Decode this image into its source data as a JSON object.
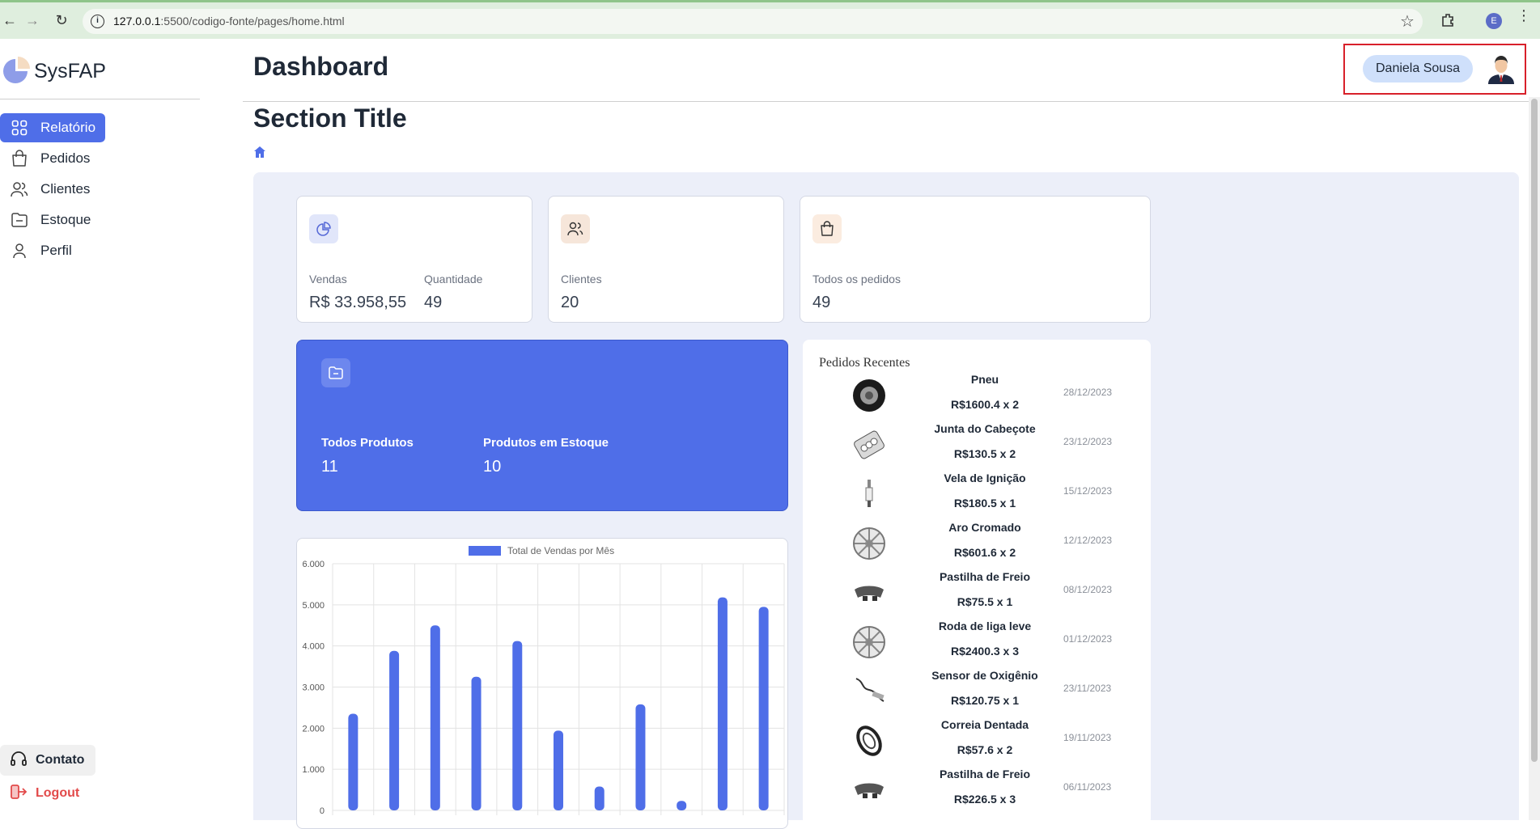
{
  "browser": {
    "url_host": "127.0.0.1",
    "url_path": ":5500/codigo-fonte/pages/home.html",
    "profile_initial": "E"
  },
  "sidebar": {
    "brand": "SysFAP",
    "items": [
      {
        "label": "Relatório",
        "icon": "grid-icon",
        "active": true
      },
      {
        "label": "Pedidos",
        "icon": "bag-icon",
        "active": false
      },
      {
        "label": "Clientes",
        "icon": "users-icon",
        "active": false
      },
      {
        "label": "Estoque",
        "icon": "folder-icon",
        "active": false
      },
      {
        "label": "Perfil",
        "icon": "user-icon",
        "active": false
      }
    ],
    "contact_label": "Contato",
    "logout_label": "Logout"
  },
  "header": {
    "title": "Dashboard",
    "user_name": "Daniela Sousa"
  },
  "section_title": "Section Title",
  "stats": {
    "sales": {
      "label": "Vendas",
      "value": "R$ 33.958,55"
    },
    "quantity": {
      "label": "Quantidade",
      "value": "49"
    },
    "clients": {
      "label": "Clientes",
      "value": "20"
    },
    "orders": {
      "label": "Todos os pedidos",
      "value": "49"
    },
    "all_products": {
      "label": "Todos Produtos",
      "value": "11"
    },
    "stock_products": {
      "label": "Produtos em Estoque",
      "value": "10"
    }
  },
  "recent_orders": {
    "title": "Pedidos Recentes",
    "items": [
      {
        "name": "Pneu",
        "price": "R$1600.4 x 2",
        "date": "28/12/2023",
        "thumb": "tire"
      },
      {
        "name": "Junta do Cabeçote",
        "price": "R$130.5 x 2",
        "date": "23/12/2023",
        "thumb": "gasket"
      },
      {
        "name": "Vela de Ignição",
        "price": "R$180.5 x 1",
        "date": "15/12/2023",
        "thumb": "spark"
      },
      {
        "name": "Aro Cromado",
        "price": "R$601.6 x 2",
        "date": "12/12/2023",
        "thumb": "rim"
      },
      {
        "name": "Pastilha de Freio",
        "price": "R$75.5 x 1",
        "date": "08/12/2023",
        "thumb": "brake"
      },
      {
        "name": "Roda de liga leve",
        "price": "R$2400.3 x 3",
        "date": "01/12/2023",
        "thumb": "rim"
      },
      {
        "name": "Sensor de Oxigênio",
        "price": "R$120.75 x 1",
        "date": "23/11/2023",
        "thumb": "sensor"
      },
      {
        "name": "Correia Dentada",
        "price": "R$57.6 x 2",
        "date": "19/11/2023",
        "thumb": "belt"
      },
      {
        "name": "Pastilha de Freio",
        "price": "R$226.5 x 3",
        "date": "06/11/2023",
        "thumb": "brake"
      }
    ]
  },
  "colors": {
    "accent": "#4f6ee8",
    "panel": "#eceff9",
    "logout": "#e24a4a",
    "highlight_border": "#d8202a"
  },
  "chart_data": {
    "type": "bar",
    "legend": "Total de Vendas por Mês",
    "series": [
      {
        "name": "Total de Vendas por Mês",
        "values": [
          2350,
          3880,
          4500,
          3250,
          4120,
          1940,
          580,
          2580,
          230,
          5180,
          4950
        ]
      }
    ],
    "yticks": [
      "6.000",
      "5.000",
      "4.000",
      "3.000",
      "2.000",
      "1.000",
      "0"
    ],
    "ylim": [
      0,
      6000
    ],
    "grid": true,
    "legend_position": "top"
  }
}
